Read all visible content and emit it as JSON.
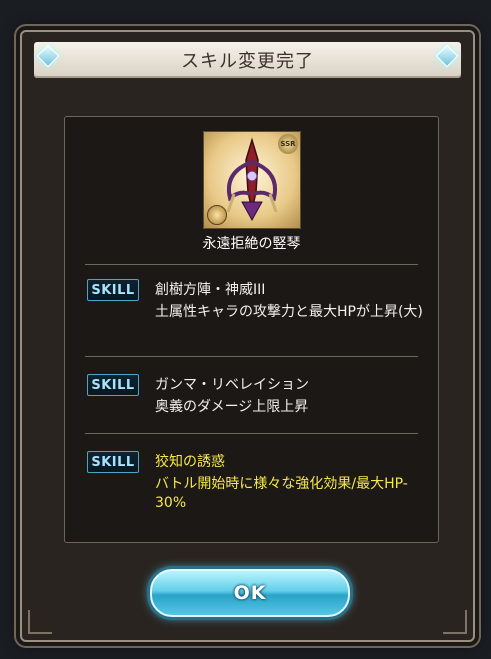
{
  "dialog": {
    "title": "スキル変更完了",
    "ok_label": "OK"
  },
  "weapon": {
    "name": "永遠拒絶の竪琴",
    "rarity": "SSR"
  },
  "skills": [
    {
      "tag": "SKILL",
      "name": "創樹方陣・神威III",
      "desc": "土属性キャラの攻撃力と最大HPが上昇(大)",
      "color": "#f3f1ec"
    },
    {
      "tag": "SKILL",
      "name": "ガンマ・リベレイション",
      "desc": "奥義のダメージ上限上昇",
      "color": "#f3f1ec"
    },
    {
      "tag": "SKILL",
      "name": "狡知の誘惑",
      "desc": "バトル開始時に様々な強化効果/最大HP-30%",
      "color": "#f6e84d"
    }
  ],
  "colors": {
    "accent": "#4fa3c7",
    "highlight_text": "#f6e84d",
    "title_bg": "#f2ede4"
  }
}
